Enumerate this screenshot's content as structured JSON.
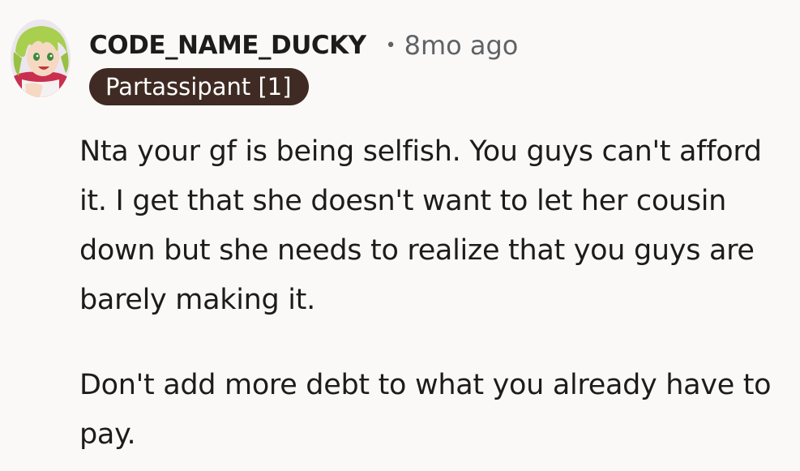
{
  "comment": {
    "username": "CODE_NAME_DUCKY",
    "separator": "•",
    "timestamp": "8mo ago",
    "flair": "Partassipant [1]",
    "paragraphs": [
      "Nta your gf is being selfish. You guys can't afford it. I get that she doesn't want to let her cousin down but she needs to realize that you guys are barely making it.",
      "Don't add more debt to what you already have to pay."
    ]
  },
  "colors": {
    "background": "#fbf9f8",
    "text": "#1c1c1c",
    "meta": "#5f6366",
    "flair_background": "#3f2b23",
    "flair_text": "#ffffff"
  }
}
